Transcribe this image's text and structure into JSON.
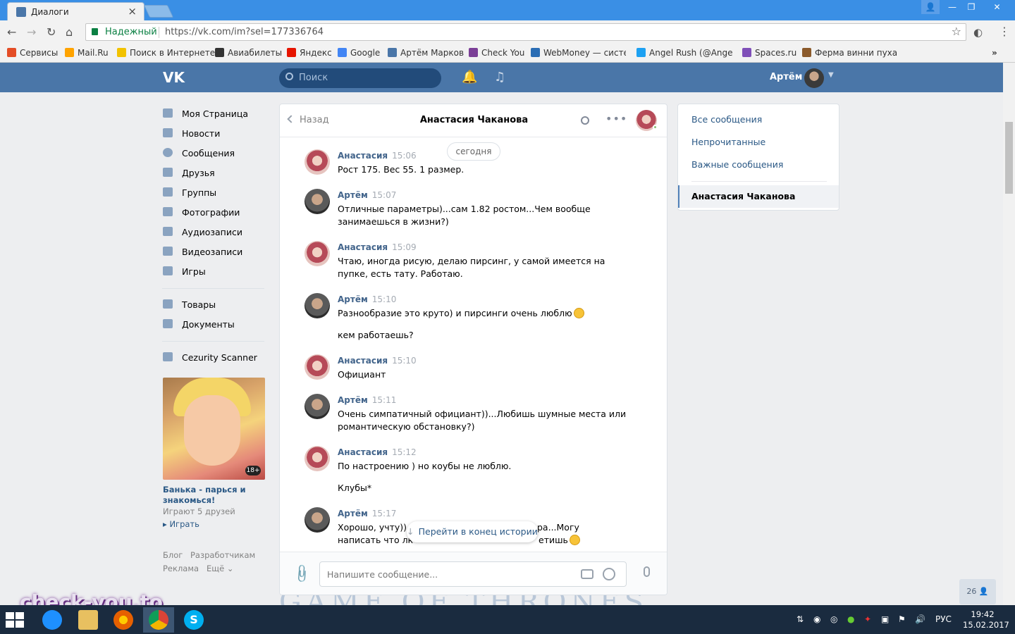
{
  "browser": {
    "tab_title": "Диалоги",
    "secure_label": "Надежный",
    "url": "https://vk.com/im?sel=177336764",
    "bookmarks": [
      {
        "label": "Сервисы",
        "color": "#e44d26"
      },
      {
        "label": "Mail.Ru",
        "color": "#ffa300"
      },
      {
        "label": "Поиск в Интернете",
        "color": "#f2c200"
      },
      {
        "label": "Авиабилеты",
        "color": "#333333"
      },
      {
        "label": "Яндекс",
        "color": "#e61400"
      },
      {
        "label": "Google",
        "color": "#4285f4"
      },
      {
        "label": "Артём Марков",
        "color": "#4a76a8"
      },
      {
        "label": "Check You",
        "color": "#7b3f97"
      },
      {
        "label": "WebMoney — систем",
        "color": "#2a6db4"
      },
      {
        "label": "Angel Rush (@AngelR",
        "color": "#1da1f2"
      },
      {
        "label": "Spaces.ru",
        "color": "#7f4fb8"
      },
      {
        "label": "Ферма винни пуха -",
        "color": "#8b5a2b"
      }
    ]
  },
  "header": {
    "search_placeholder": "Поиск",
    "user_name": "Артём"
  },
  "left_menu": {
    "items": [
      "Моя Страница",
      "Новости",
      "Сообщения",
      "Друзья",
      "Группы",
      "Фотографии",
      "Аудиозаписи",
      "Видеозаписи",
      "Игры"
    ],
    "items2": [
      "Товары",
      "Документы"
    ],
    "apps": [
      "Cezurity Scanner"
    ],
    "ad": {
      "badge": "18+",
      "title": "Банька - парься и знакомься!",
      "subtitle": "Играют 5 друзей",
      "play": "Играть"
    },
    "footer": {
      "blog": "Блог",
      "developers": "Разработчикам",
      "ads": "Реклама",
      "more": "Ещё"
    }
  },
  "chat": {
    "back_label": "Назад",
    "title": "Анастасия Чаканова",
    "date_divider": "сегодня",
    "messages": [
      {
        "author": "Анастасия",
        "time": "15:06",
        "text": "Рост 175. Вес 55. 1 размер."
      },
      {
        "author": "Артём",
        "time": "15:07",
        "text": "Отличные параметры)...сам 1.82 ростом...Чем вообще занимаешься в жизни?)"
      },
      {
        "author": "Анастасия",
        "time": "15:09",
        "text": "Чтаю, иногда рисую, делаю пирсинг, у самой имеется на пупке, есть тату. Работаю."
      },
      {
        "author": "Артём",
        "time": "15:10",
        "text": "Разнообразие это круто) и пирсинги очень люблю",
        "text2": "кем работаешь?"
      },
      {
        "author": "Анастасия",
        "time": "15:10",
        "text": "Официант"
      },
      {
        "author": "Артём",
        "time": "15:11",
        "text": "Очень симпатичный официант))...Любишь шумные места или романтическую обстановку?)"
      },
      {
        "author": "Анастасия",
        "time": "15:12",
        "text": "По настроению ) но коубы не люблю.",
        "text2": "Клубы*"
      },
      {
        "author": "Артём",
        "time": "15:17",
        "text": "Хорошо, учту))..",
        "text_right": "ра...Могу",
        "text_line2_left": "написать что лк",
        "text_line2_right": "етишь"
      }
    ],
    "jump_label": "Перейти в конец истории",
    "composer_placeholder": "Напишите сообщение..."
  },
  "filters": {
    "items": [
      "Все сообщения",
      "Непрочитанные",
      "Важные сообщения"
    ],
    "active_dialog": "Анастасия Чаканова"
  },
  "friends_online": "26",
  "banner_text": "GAME OF THRONES",
  "watermark": "check-you.to",
  "taskbar": {
    "lang": "РУС",
    "time": "19:42",
    "date": "15.02.2017"
  }
}
